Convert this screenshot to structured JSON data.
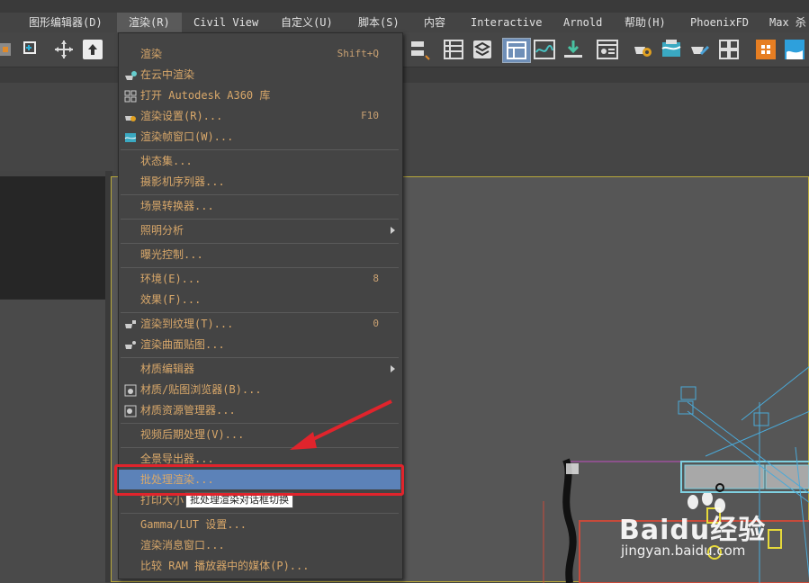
{
  "menubar": {
    "items": [
      {
        "label": "图形编辑器(D)",
        "id": "graph"
      },
      {
        "label": "渲染(R)",
        "id": "render"
      },
      {
        "label": "Civil View",
        "id": "civil"
      },
      {
        "label": "自定义(U)",
        "id": "custom"
      },
      {
        "label": "脚本(S)",
        "id": "script"
      },
      {
        "label": "内容",
        "id": "content"
      },
      {
        "label": "Interactive",
        "id": "interactive"
      },
      {
        "label": "Arnold",
        "id": "arnold"
      },
      {
        "label": "帮助(H)",
        "id": "help"
      },
      {
        "label": "PhoenixFD",
        "id": "phoenix"
      },
      {
        "label": "Max 杀",
        "id": "max"
      }
    ]
  },
  "menu": {
    "items": [
      {
        "label": "渲染",
        "shortcut": "Shift+Q"
      },
      {
        "label": "在云中渲染",
        "shortcut": ""
      },
      {
        "label": "打开 Autodesk A360 库",
        "shortcut": ""
      },
      {
        "label": "渲染设置(R)...",
        "shortcut": "F10"
      },
      {
        "label": "渲染帧窗口(W)...",
        "shortcut": ""
      },
      {
        "label": "状态集...",
        "shortcut": ""
      },
      {
        "label": "摄影机序列器...",
        "shortcut": ""
      },
      {
        "label": "场景转换器...",
        "shortcut": ""
      },
      {
        "label": "照明分析",
        "shortcut": ""
      },
      {
        "label": "曝光控制...",
        "shortcut": ""
      },
      {
        "label": "环境(E)...",
        "shortcut": "8"
      },
      {
        "label": "效果(F)...",
        "shortcut": ""
      },
      {
        "label": "渲染到纹理(T)...",
        "shortcut": "0"
      },
      {
        "label": "渲染曲面贴图...",
        "shortcut": ""
      },
      {
        "label": "材质编辑器",
        "shortcut": ""
      },
      {
        "label": "材质/贴图浏览器(B)...",
        "shortcut": ""
      },
      {
        "label": "材质资源管理器...",
        "shortcut": ""
      },
      {
        "label": "视频后期处理(V)...",
        "shortcut": ""
      },
      {
        "label": "全景导出器...",
        "shortcut": ""
      },
      {
        "label": "批处理渲染...",
        "shortcut": ""
      },
      {
        "label": "打印大小",
        "shortcut": ""
      },
      {
        "label": "Gamma/LUT 设置...",
        "shortcut": ""
      },
      {
        "label": "渲染消息窗口...",
        "shortcut": ""
      },
      {
        "label": "比较 RAM 播放器中的媒体(P)...",
        "shortcut": ""
      }
    ]
  },
  "tooltip": {
    "text": "批处理渲染对话框切换"
  },
  "watermark": {
    "line1": "Baidu经验",
    "line2": "jingyan.baidu.com"
  },
  "colors": {
    "accent_highlight": "#5c82b8",
    "menu_text": "#d9a86a",
    "annotation_red": "#e0242c",
    "viewport_border": "#b9a93b"
  }
}
